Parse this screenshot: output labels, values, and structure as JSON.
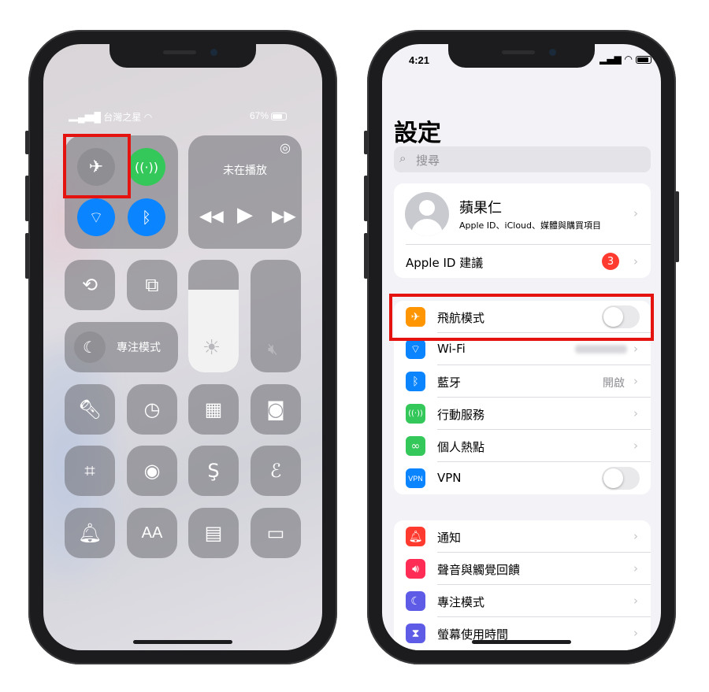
{
  "control_center": {
    "carrier": "台灣之星",
    "battery": "67%",
    "now_playing": "未在播放",
    "focus_label": "專注模式",
    "icons": [
      "airplane-icon",
      "cellular-icon",
      "wifi-icon",
      "bluetooth-icon",
      "airplay-icon",
      "rewind-icon",
      "play-icon",
      "fast-forward-icon",
      "rotation-lock-icon",
      "screen-mirroring-icon",
      "brightness-icon",
      "mute-icon",
      "moon-icon",
      "flashlight-icon",
      "timer-icon",
      "calculator-icon",
      "camera-icon",
      "qr-scanner-icon",
      "screen-record-icon",
      "shazam-icon",
      "hearing-icon",
      "silent-mode-icon",
      "text-size-icon",
      "quick-note-icon",
      "low-power-icon"
    ],
    "text_size_glyph": "AA"
  },
  "settings": {
    "time": "4:21",
    "title": "設定",
    "search_placeholder": "搜尋",
    "profile": {
      "name": "蘋果仁",
      "subtitle": "Apple ID、iCloud、媒體與購買項目"
    },
    "apple_id_suggestions": "Apple ID 建議",
    "apple_id_badge": "3",
    "group1": [
      {
        "label": "飛航模式",
        "icon": "airplane-icon",
        "color": "#ff9500",
        "control": "toggle"
      },
      {
        "label": "Wi-Fi",
        "icon": "wifi-icon",
        "color": "#0a84ff",
        "control": "chevron"
      },
      {
        "label": "藍牙",
        "icon": "bluetooth-icon",
        "color": "#0a84ff",
        "value": "開啟",
        "control": "chevron"
      },
      {
        "label": "行動服務",
        "icon": "cellular-icon",
        "color": "#34c759",
        "control": "chevron"
      },
      {
        "label": "個人熱點",
        "icon": "hotspot-icon",
        "color": "#34c759",
        "control": "chevron"
      },
      {
        "label": "VPN",
        "icon": "vpn-icon",
        "color": "#0a84ff",
        "control": "toggle",
        "badge_text": "VPN"
      }
    ],
    "group2": [
      {
        "label": "通知",
        "icon": "notifications-icon",
        "color": "#ff3b30"
      },
      {
        "label": "聲音與觸覺回饋",
        "icon": "sound-icon",
        "color": "#ff2d55"
      },
      {
        "label": "專注模式",
        "icon": "moon-icon",
        "color": "#5e5ce6"
      },
      {
        "label": "螢幕使用時間",
        "icon": "hourglass-icon",
        "color": "#5e5ce6"
      }
    ]
  },
  "colors": {
    "highlight": "#e5130f",
    "accent_green": "#34c759",
    "accent_blue": "#0a84ff"
  }
}
